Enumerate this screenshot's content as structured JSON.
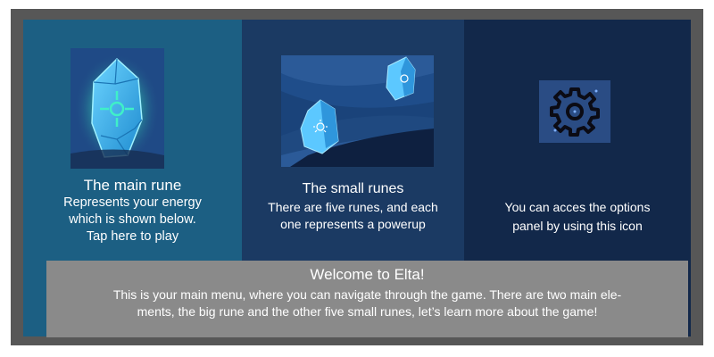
{
  "colors": {
    "frame": "#575757",
    "panel_left": "#1c5f83",
    "panel_mid": "#1b3a63",
    "panel_right": "#12284a",
    "welcome_bg": "#8a8a8a",
    "rune_blue": "#3fb6ea",
    "rune_glow": "#46e0c8"
  },
  "panels": [
    {
      "title": "The main rune",
      "desc_lines": [
        "Represents your energy",
        "which is shown below.",
        "Tap here to play"
      ],
      "icon": "main-rune-icon"
    },
    {
      "title": "The small runes",
      "desc_lines": [
        "There are five runes, and each",
        "one represents a powerup"
      ],
      "icon": "small-runes-icon"
    },
    {
      "desc_lines": [
        "You can acces the options",
        "panel by using this icon"
      ],
      "icon": "gear-icon"
    }
  ],
  "welcome": {
    "title": "Welcome to Elta!",
    "lines": [
      "This is your main menu, where you can navigate through the game. There are two main ele-",
      "ments, the big rune and the other five small runes, let’s learn more about the game!"
    ]
  }
}
